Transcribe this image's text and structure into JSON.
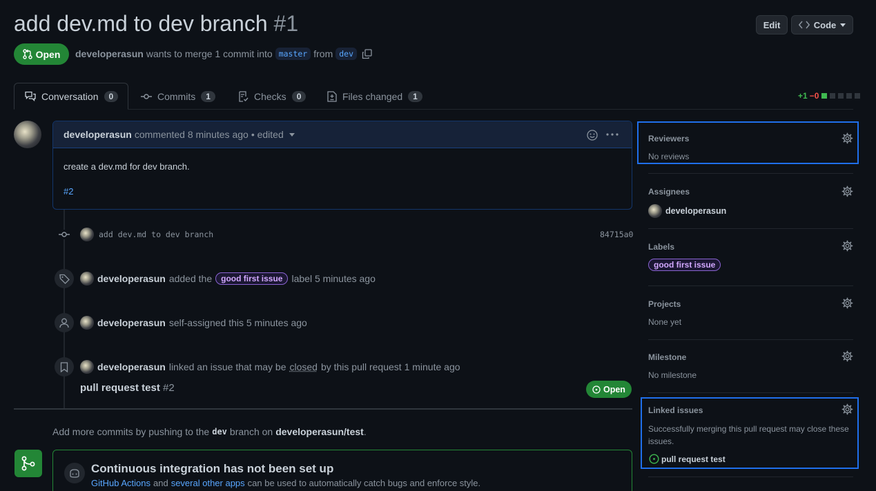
{
  "header": {
    "title": "add dev.md to dev branch",
    "number": "#1",
    "edit_label": "Edit",
    "code_label": "Code",
    "state_label": "Open",
    "author": "developerasun",
    "merge_text": "wants to merge 1 commit into",
    "base_branch": "master",
    "from_text": "from",
    "head_branch": "dev"
  },
  "tabs": [
    {
      "label": "Conversation",
      "count": "0"
    },
    {
      "label": "Commits",
      "count": "1"
    },
    {
      "label": "Checks",
      "count": "0"
    },
    {
      "label": "Files changed",
      "count": "1"
    }
  ],
  "diffstat": {
    "additions": "+1",
    "deletions": "−0"
  },
  "comment": {
    "author": "developerasun",
    "meta": "commented 8 minutes ago",
    "edited": "• edited",
    "body": "create a dev.md for dev branch.",
    "ref": "#2"
  },
  "timeline": {
    "commit_message": "add dev.md to dev branch",
    "commit_sha": "84715a0",
    "label_event": {
      "actor": "developerasun",
      "pre": "added the",
      "label": "good first issue",
      "post": "label 5 minutes ago"
    },
    "assign_event": {
      "actor": "developerasun",
      "text": "self-assigned this 5 minutes ago"
    },
    "link_event": {
      "actor": "developerasun",
      "pre": "linked an issue that may be",
      "closed": "closed",
      "post": "by this pull request 1 minute ago"
    },
    "linked_issue": {
      "title": "pull request test",
      "number": "#2",
      "state": "Open"
    }
  },
  "push_hint": {
    "pre": "Add more commits by pushing to the",
    "branch": "dev",
    "mid": "branch on",
    "repo": "developerasun/test",
    "end": "."
  },
  "ci": {
    "title": "Continuous integration has not been set up",
    "actions_link": "GitHub Actions",
    "and": "and",
    "apps_link": "several other apps",
    "rest": "can be used to automatically catch bugs and enforce style."
  },
  "sidebar": {
    "reviewers": {
      "title": "Reviewers",
      "value": "No reviews"
    },
    "assignees": {
      "title": "Assignees",
      "value": "developerasun"
    },
    "labels": {
      "title": "Labels",
      "value": "good first issue"
    },
    "projects": {
      "title": "Projects",
      "value": "None yet"
    },
    "milestone": {
      "title": "Milestone",
      "value": "No milestone"
    },
    "linked_issues": {
      "title": "Linked issues",
      "desc": "Successfully merging this pull request may close these issues.",
      "issue": "pull request test"
    }
  },
  "colors": {
    "accent": "#1f6feb",
    "open": "#238636",
    "link": "#58a6ff",
    "label": "#8a63d2",
    "background": "#0d1117"
  }
}
